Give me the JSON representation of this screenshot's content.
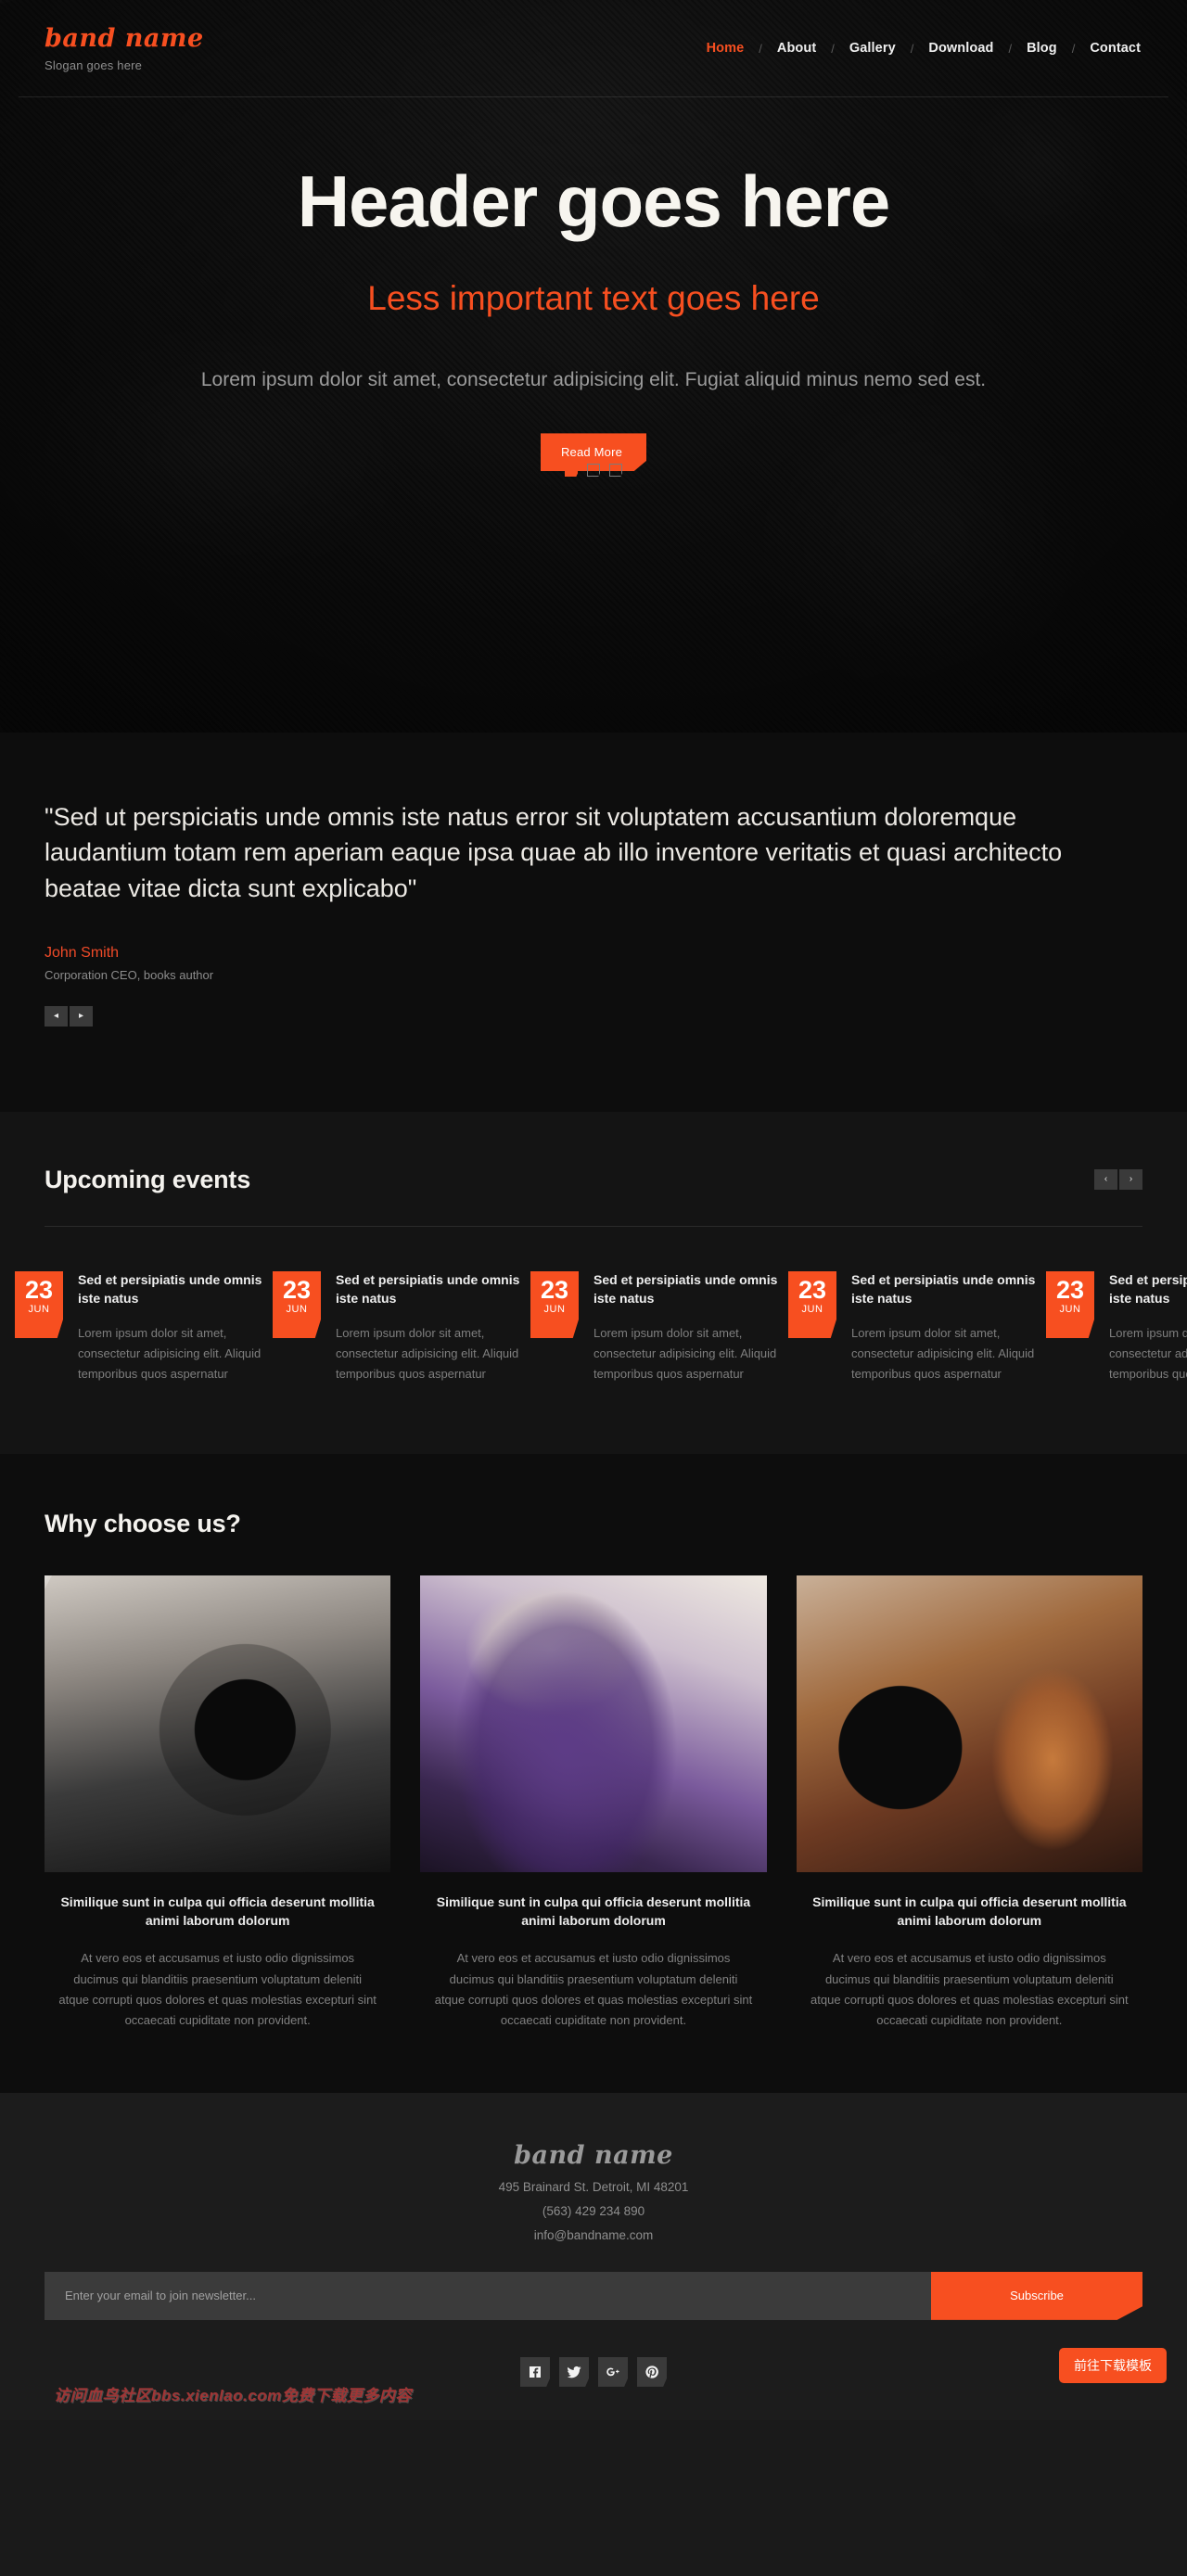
{
  "brand": {
    "name": "band name",
    "slogan": "Slogan goes here"
  },
  "nav": {
    "separator": "/",
    "items": [
      {
        "label": "Home",
        "active": true
      },
      {
        "label": "About",
        "active": false
      },
      {
        "label": "Gallery",
        "active": false
      },
      {
        "label": "Download",
        "active": false
      },
      {
        "label": "Blog",
        "active": false
      },
      {
        "label": "Contact",
        "active": false
      }
    ]
  },
  "hero": {
    "title": "Header goes here",
    "subtitle": "Less important text goes here",
    "description": "Lorem ipsum dolor sit amet, consectetur adipisicing elit. Fugiat aliquid minus nemo sed est.",
    "button_label": "Read More",
    "slides": [
      {
        "active": true
      },
      {
        "active": false
      },
      {
        "active": false
      }
    ]
  },
  "testimonial": {
    "quote": "\"Sed ut perspiciatis unde omnis iste natus error sit voluptatem accusantium doloremque laudantium totam rem aperiam eaque ipsa quae ab illo inventore veritatis et quasi architecto beatae vitae dicta sunt explicabo\"",
    "author": "John Smith",
    "role": "Corporation CEO, books author",
    "prev_label": "◂",
    "next_label": "▸"
  },
  "events": {
    "title": "Upcoming events",
    "prev_label": "‹",
    "next_label": "›",
    "items": [
      {
        "day": "23",
        "month": "JUN",
        "title": "Sed et persipiatis unde omnis iste natus",
        "text": "Lorem ipsum dolor sit amet, consectetur adipisicing elit. Aliquid temporibus quos aspernatur"
      },
      {
        "day": "23",
        "month": "JUN",
        "title": "Sed et persipiatis unde omnis iste natus",
        "text": "Lorem ipsum dolor sit amet, consectetur adipisicing elit. Aliquid temporibus quos aspernatur"
      },
      {
        "day": "23",
        "month": "JUN",
        "title": "Sed et persipiatis unde omnis iste natus",
        "text": "Lorem ipsum dolor sit amet, consectetur adipisicing elit. Aliquid temporibus quos aspernatur"
      },
      {
        "day": "23",
        "month": "JUN",
        "title": "Sed et persipiatis unde omnis iste natus",
        "text": "Lorem ipsum dolor sit amet, consectetur adipisicing elit. Aliquid temporibus quos aspernatur"
      },
      {
        "day": "23",
        "month": "JUN",
        "title": "Sed et persipiatis unde omnis iste natus",
        "text": "Lorem ipsum dolor sit amet, consectetur adipisicing elit. Aliquid temporibus quos aspernatur"
      }
    ]
  },
  "features": {
    "title": "Why choose us?",
    "items": [
      {
        "image": "headphones-on-piano-photo",
        "title": "Similique sunt in culpa qui officia deserunt mollitia animi laborum dolorum",
        "text": "At vero eos et accusamus et iusto odio dignissimos ducimus qui blanditiis praesentium voluptatum deleniti atque corrupti quos dolores et quas molestias excepturi sint occaecati cupiditate non provident."
      },
      {
        "image": "dj-at-turntables-photo",
        "title": "Similique sunt in culpa qui officia deserunt mollitia animi laborum dolorum",
        "text": "At vero eos et accusamus et iusto odio dignissimos ducimus qui blanditiis praesentium voluptatum deleniti atque corrupti quos dolores et quas molestias excepturi sint occaecati cupiditate non provident."
      },
      {
        "image": "vinyl-record-and-guitar-photo",
        "title": "Similique sunt in culpa qui officia deserunt mollitia animi laborum dolorum",
        "text": "At vero eos et accusamus et iusto odio dignissimos ducimus qui blanditiis praesentium voluptatum deleniti atque corrupti quos dolores et quas molestias excepturi sint occaecati cupiditate non provident."
      }
    ]
  },
  "footer": {
    "brand": "band name",
    "address": "495 Brainard St. Detroit, MI 48201",
    "phone": "(563) 429 234 890",
    "email": "info@bandname.com",
    "newsletter": {
      "placeholder": "Enter your email to join newsletter...",
      "value": "",
      "button_label": "Subscribe"
    },
    "socials": [
      {
        "name": "facebook-icon"
      },
      {
        "name": "twitter-icon"
      },
      {
        "name": "google-plus-icon"
      },
      {
        "name": "pinterest-icon"
      }
    ]
  },
  "overlay": {
    "watermark": "访问血鸟社区bbs.xienlao.com免费下载更多内容",
    "download_button": "前往下载模板"
  },
  "colors": {
    "accent": "#f74f20",
    "page_bg": "#1a1a1a",
    "dark_bg": "#0d0d0d",
    "muted_text": "#808080"
  }
}
